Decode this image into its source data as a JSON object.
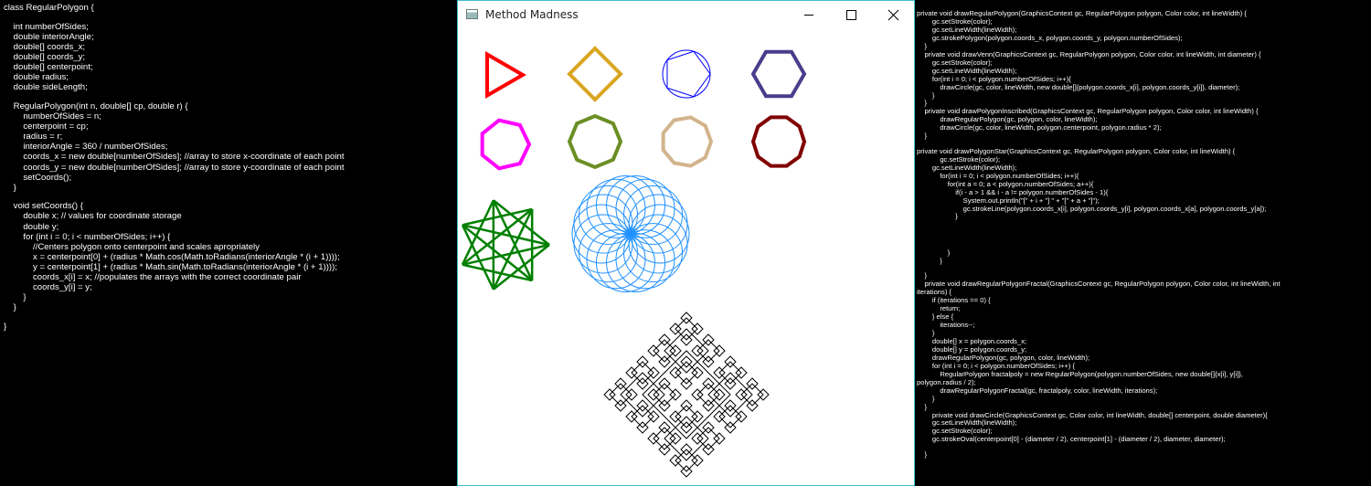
{
  "window": {
    "title": "Method Madness"
  },
  "colors": {
    "red": "#ff0000",
    "goldenrod": "#daa520",
    "blue": "#0000ff",
    "darkslateblue": "#483d8b",
    "magenta": "#ff00ff",
    "olivedrab": "#6b8e23",
    "tan": "#d2b48c",
    "maroon": "#800000",
    "green": "#008000",
    "dodgerblue": "#1e90ff",
    "black": "#000000",
    "accent": "#3ec0cf"
  },
  "left_code": [
    "class RegularPolygon {",
    "",
    "    int numberOfSides;",
    "    double interiorAngle;",
    "    double[] coords_x;",
    "    double[] coords_y;",
    "    double[] centerpoint;",
    "    double radius;",
    "    double sideLength;",
    "",
    "    RegularPolygon(int n, double[] cp, double r) {",
    "        numberOfSides = n;",
    "        centerpoint = cp;",
    "        radius = r;",
    "        interiorAngle = 360 / numberOfSides;",
    "        coords_x = new double[numberOfSides]; //array to store x-coordinate of each point",
    "        coords_y = new double[numberOfSides]; //array to store y-coordinate of each point",
    "        setCoords();",
    "    }",
    "",
    "    void setCoords() {",
    "        double x; // values for coordinate storage",
    "        double y;",
    "        for (int i = 0; i < numberOfSides; i++) {",
    "            //Centers polygon onto centerpoint and scales apropriately",
    "            x = centerpoint[0] + (radius * Math.cos(Math.toRadians(interiorAngle * (i + 1))));",
    "            y = centerpoint[1] + (radius * Math.sin(Math.toRadians(interiorAngle * (i + 1))));",
    "            coords_x[i] = x; //populates the arrays with the correct coordinate pair",
    "            coords_y[i] = y;",
    "        }",
    "    }",
    "",
    "}"
  ],
  "right_code": [
    "private void drawRegularPolygon(GraphicsContext gc, RegularPolygon polygon, Color color, int lineWidth) {",
    "        gc.setStroke(color);",
    "        gc.setLineWidth(lineWidth);",
    "        gc.strokePolygon(polygon.coords_x, polygon.coords_y, polygon.numberOfSides);",
    "    }",
    "    private void drawVenn(GraphicsContext gc, RegularPolygon polygon, Color color, int lineWidth, int diameter) {",
    "        gc.setStroke(color);",
    "        gc.setLineWidth(lineWidth);",
    "        for(int i = 0; i < polygon.numberOfSides; i++){",
    "            drawCircle(gc, color, lineWidth, new double[]{polygon.coords_x[i], polygon.coords_y[i]}, diameter);",
    "        }",
    "    }",
    "    private void drawPolygonInscribed(GraphicsContext gc, RegularPolygon polygon, Color color, int lineWidth) {",
    "            drawRegularPolygon(gc, polygon, color, lineWidth);",
    "            drawCircle(gc, color, lineWidth, polygon.centerpoint, polygon.radius * 2);",
    "    }",
    "",
    "private void drawPolygonStar(GraphicsContext gc, RegularPolygon polygon, Color color, int lineWidth) {",
    "            gc.setStroke(color);",
    "        gc.setLineWidth(lineWidth);",
    "            for(int i = 0; i < polygon.numberOfSides; i++){",
    "                for(int a = 0; a < polygon.numberOfSides; a++){",
    "                    if(i - a > 1 && i - a != polygon.numberOfSides - 1){",
    "                        System.out.println(\"[\" + i + \"] \" + \"[\" + a + \"]\");",
    "                        gc.strokeLine(polygon.coords_x[i], polygon.coords_y[i], polygon.coords_x[a], polygon.coords_y[a]);",
    "                    }",
    "",
    "",
    "",
    "",
    "                }",
    "            }",
    "",
    "    }",
    "    private void drawRegularPolygonFractal(GraphicsContext gc, RegularPolygon polygon, Color color, int lineWidth, int",
    "iterations) {",
    "        if (iterations == 0) {",
    "            return;",
    "        } else {",
    "            iterations--;",
    "        }",
    "        double[] x = polygon.coords_x;",
    "        double[] y = polygon.coords_y;",
    "        drawRegularPolygon(gc, polygon, color, lineWidth);",
    "        for (int i = 0; i < polygon.numberOfSides; i++) {",
    "            RegularPolygon fractalpoly = new RegularPolygon(polygon.numberOfSides, new double[]{x[i], y[i]},",
    "polygon.radius / 2);",
    "            drawRegularPolygonFractal(gc, fractalpoly, color, lineWidth, iterations);",
    "        }",
    "    }",
    "        private void drawCircle(GraphicsContext gc, Color color, int lineWidth, double[] centerpoint, double diameter){",
    "        gc.setLineWidth(lineWidth);",
    "        gc.setStroke(color);",
    "        gc.strokeOval(centerpoint[0] - (diameter / 2), centerpoint[1] - (diameter / 2), diameter, diameter);",
    "",
    "    }"
  ],
  "shapes": [
    {
      "name": "red-triangle",
      "kind": "polygon",
      "sides": 3,
      "color": "red"
    },
    {
      "name": "goldenrod-diamond",
      "kind": "polygon",
      "sides": 4,
      "color": "goldenrod"
    },
    {
      "name": "blue-inscribed-pentagon",
      "kind": "inscribed",
      "sides": 5,
      "color": "blue"
    },
    {
      "name": "darkslateblue-hexagon",
      "kind": "polygon",
      "sides": 6,
      "color": "darkslateblue"
    },
    {
      "name": "magenta-heptagon",
      "kind": "polygon",
      "sides": 7,
      "color": "magenta"
    },
    {
      "name": "olivedrab-octagon",
      "kind": "polygon",
      "sides": 8,
      "color": "olivedrab"
    },
    {
      "name": "tan-nonagon",
      "kind": "polygon",
      "sides": 9,
      "color": "tan"
    },
    {
      "name": "maroon-decagon",
      "kind": "polygon",
      "sides": 10,
      "color": "maroon"
    },
    {
      "name": "green-star",
      "kind": "star",
      "sides": 7,
      "color": "green"
    },
    {
      "name": "blue-venn-rosette",
      "kind": "venn",
      "sides": 18,
      "color": "dodgerblue"
    },
    {
      "name": "black-diamond-fractal",
      "kind": "fractal",
      "sides": 4,
      "iterations": 4,
      "color": "black"
    }
  ]
}
